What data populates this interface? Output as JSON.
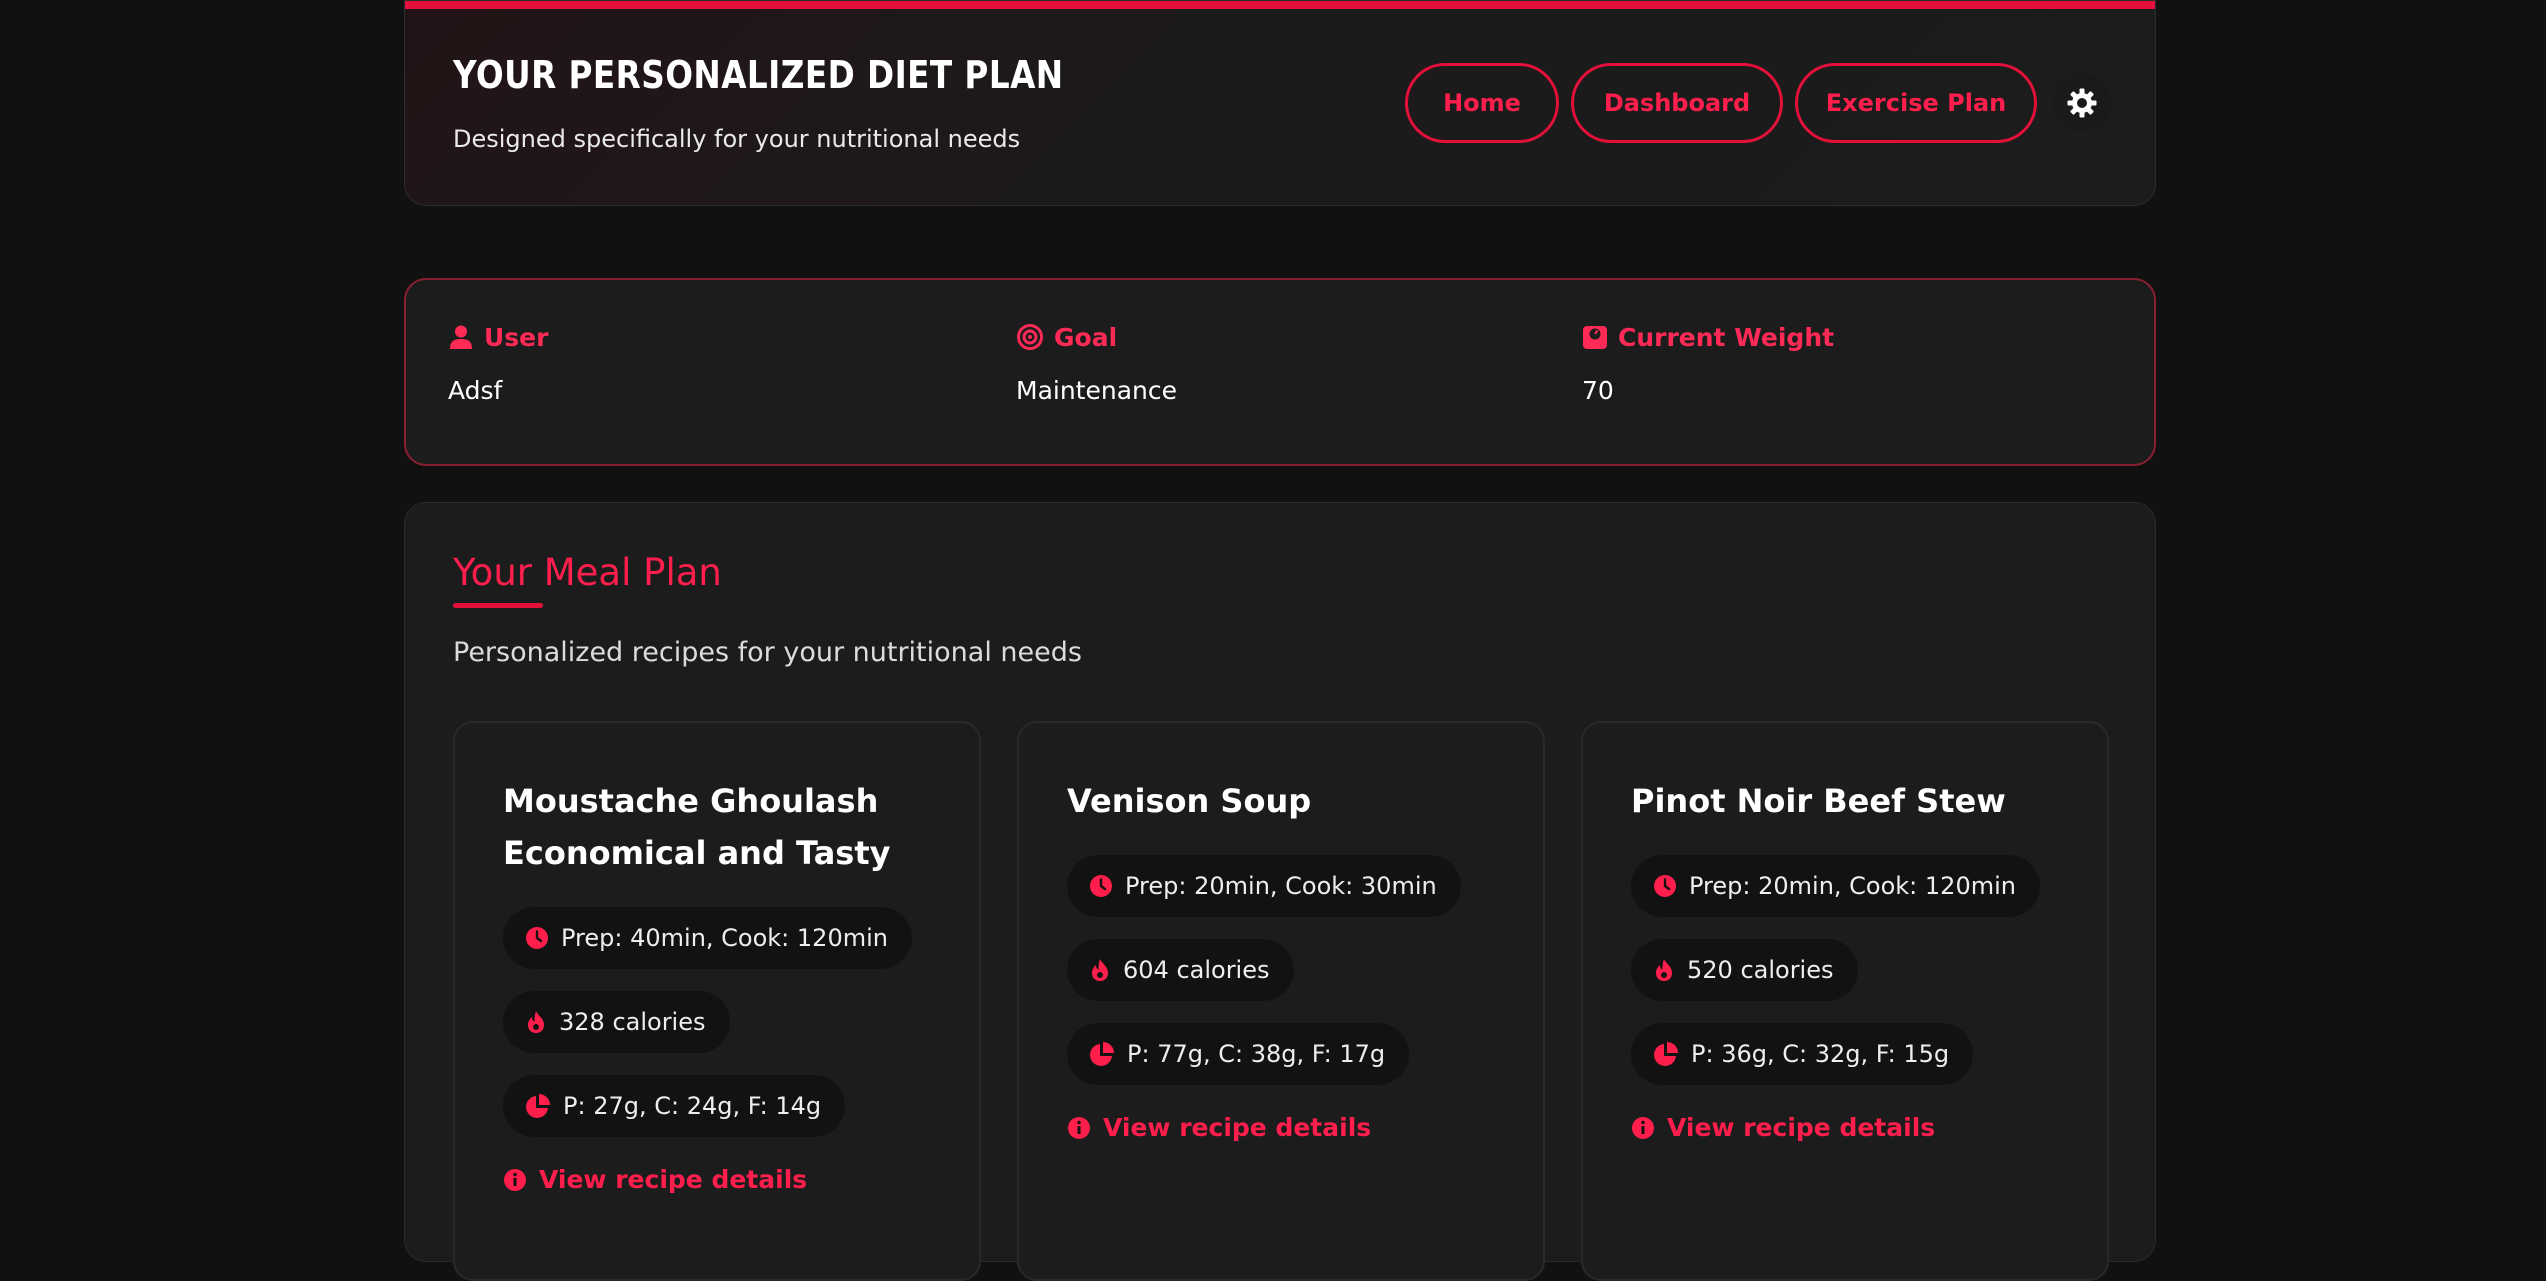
{
  "header": {
    "title": "YOUR PERSONALIZED DIET PLAN",
    "subtitle": "Designed specifically for your nutritional needs",
    "nav": [
      "Home",
      "Dashboard",
      "Exercise Plan"
    ],
    "theme_icon": "gear-icon"
  },
  "info": {
    "user_label": "User",
    "user_value": "Adsf",
    "goal_label": "Goal",
    "goal_value": "Maintenance",
    "weight_label": "Current Weight",
    "weight_value": "70"
  },
  "meal_plan": {
    "title": "Your Meal Plan",
    "subtitle": "Personalized recipes for your nutritional needs",
    "recipes": [
      {
        "name": "Moustache Ghoulash Economical and Tasty",
        "time": "Prep: 40min, Cook: 120min",
        "calories": "328 calories",
        "macros": "P: 27g, C: 24g, F: 14g",
        "link": "View recipe details"
      },
      {
        "name": "Venison Soup",
        "time": "Prep: 20min, Cook: 30min",
        "calories": "604 calories",
        "macros": "P: 77g, C: 38g, F: 17g",
        "link": "View recipe details"
      },
      {
        "name": "Pinot Noir Beef Stew",
        "time": "Prep: 20min, Cook: 120min",
        "calories": "520 calories",
        "macros": "P: 36g, C: 32g, F: 15g",
        "link": "View recipe details"
      }
    ]
  },
  "colors": {
    "accent": "#e3103a",
    "background": "#111111",
    "card": "#1c1c1c"
  }
}
